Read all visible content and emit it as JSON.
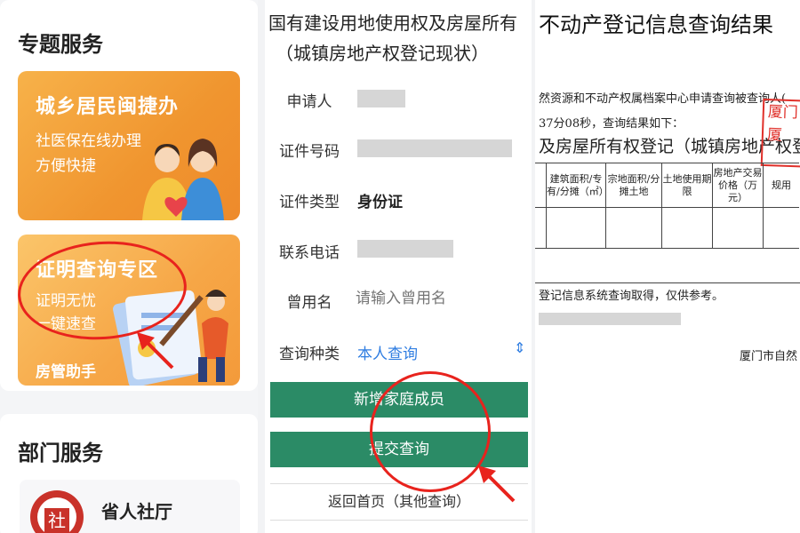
{
  "left": {
    "section1_title": "专题服务",
    "banner1": {
      "title": "城乡居民闽捷办",
      "line1": "社医保在线办理",
      "line2": "方便快捷"
    },
    "banner2": {
      "title": "证明查询专区",
      "line1": "证明无忧",
      "line2": "一键速查",
      "tag": "房管助手"
    },
    "section2_title": "部门服务",
    "dept": {
      "name": "省人社厅",
      "seal_char": "社"
    }
  },
  "middle": {
    "header_line1": "国有建设用地使用权及房屋所有",
    "header_line2": "（城镇房地产权登记现状）",
    "rows": [
      {
        "label": "申请人",
        "value": ""
      },
      {
        "label": "证件号码",
        "value": ""
      },
      {
        "label": "证件类型",
        "value": "身份证"
      },
      {
        "label": "联系电话",
        "value": ""
      },
      {
        "label": "曾用名",
        "placeholder": "请输入曾用名"
      },
      {
        "label": "查询种类",
        "value": "本人查询"
      }
    ],
    "add_member_button": "新增家庭成员",
    "submit_button": "提交查询",
    "back_button": "返回首页（其他查询）"
  },
  "right": {
    "title": "不动产登记信息查询结果",
    "line1": "然资源和不动产权属档案中心申请查询被查询人(",
    "line2": "37分08秒，查询结果如下：",
    "subtitle": "及房屋所有权登记（城镇房地产权登",
    "table_headers": [
      "建筑面积/专有/分摊（㎡）",
      "宗地面积/分摊土地",
      "土地使用期限",
      "房地产交易价格（万元）",
      "规用"
    ],
    "note": "登记信息系统查询取得，仅供参考。",
    "footer": "厦门市自然",
    "stamp_line1": "厦门",
    "stamp_line2": "厦"
  },
  "colors": {
    "green": "#2b8b66",
    "link_blue": "#2f7de1",
    "red_annotation": "#e8231d"
  }
}
